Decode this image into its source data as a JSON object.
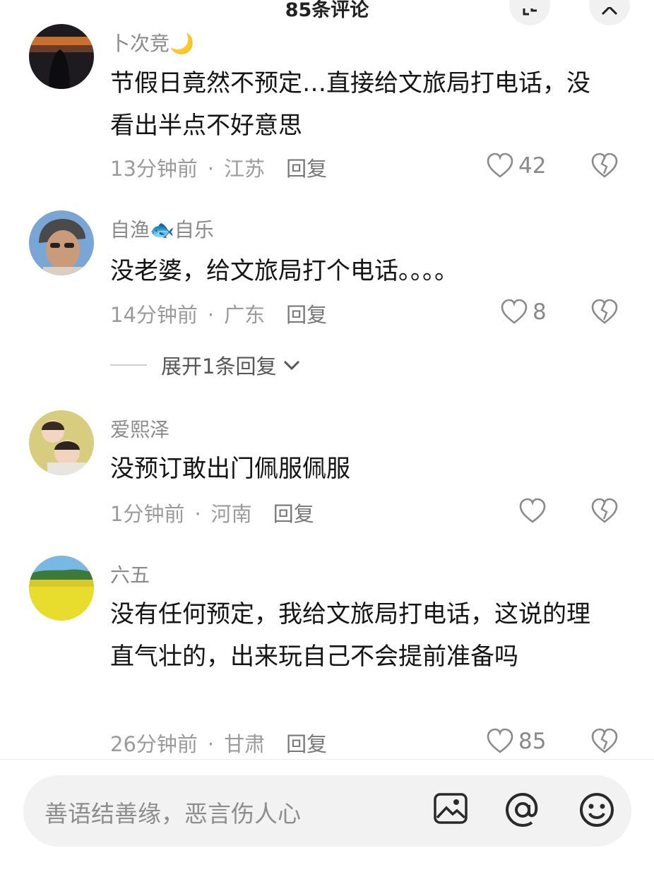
{
  "header": {
    "title": "85条评论"
  },
  "comments": [
    {
      "username": "卜次竞🌙",
      "text": "节假日竟然不预定…直接给文旅局打电话，没看出半点不好意思",
      "time": "13分钟前",
      "location": "江苏",
      "reply": "回复",
      "likes": "42"
    },
    {
      "username": "自渔🐟自乐",
      "text": "没老婆，给文旅局打个电话。。。。",
      "time": "14分钟前",
      "location": "广东",
      "reply": "回复",
      "likes": "8",
      "expand_replies": "展开1条回复"
    },
    {
      "username": "爱熙泽",
      "text": "没预订敢出门佩服佩服",
      "time": "1分钟前",
      "location": "河南",
      "reply": "回复",
      "likes": ""
    },
    {
      "username": "六五",
      "text": "没有任何预定，我给文旅局打电话，这说的理直气壮的，出来玩自己不会提前准备吗",
      "time": "26分钟前",
      "location": "甘肃",
      "reply": "回复",
      "likes": "85"
    }
  ],
  "separator": "·",
  "input": {
    "placeholder": "善语结善缘，恶言伤人心"
  },
  "icons": [
    "expand-icon",
    "close-icon",
    "heart-icon",
    "broken-heart-icon",
    "chevron-down-icon",
    "image-icon",
    "at-icon",
    "emoji-icon"
  ]
}
